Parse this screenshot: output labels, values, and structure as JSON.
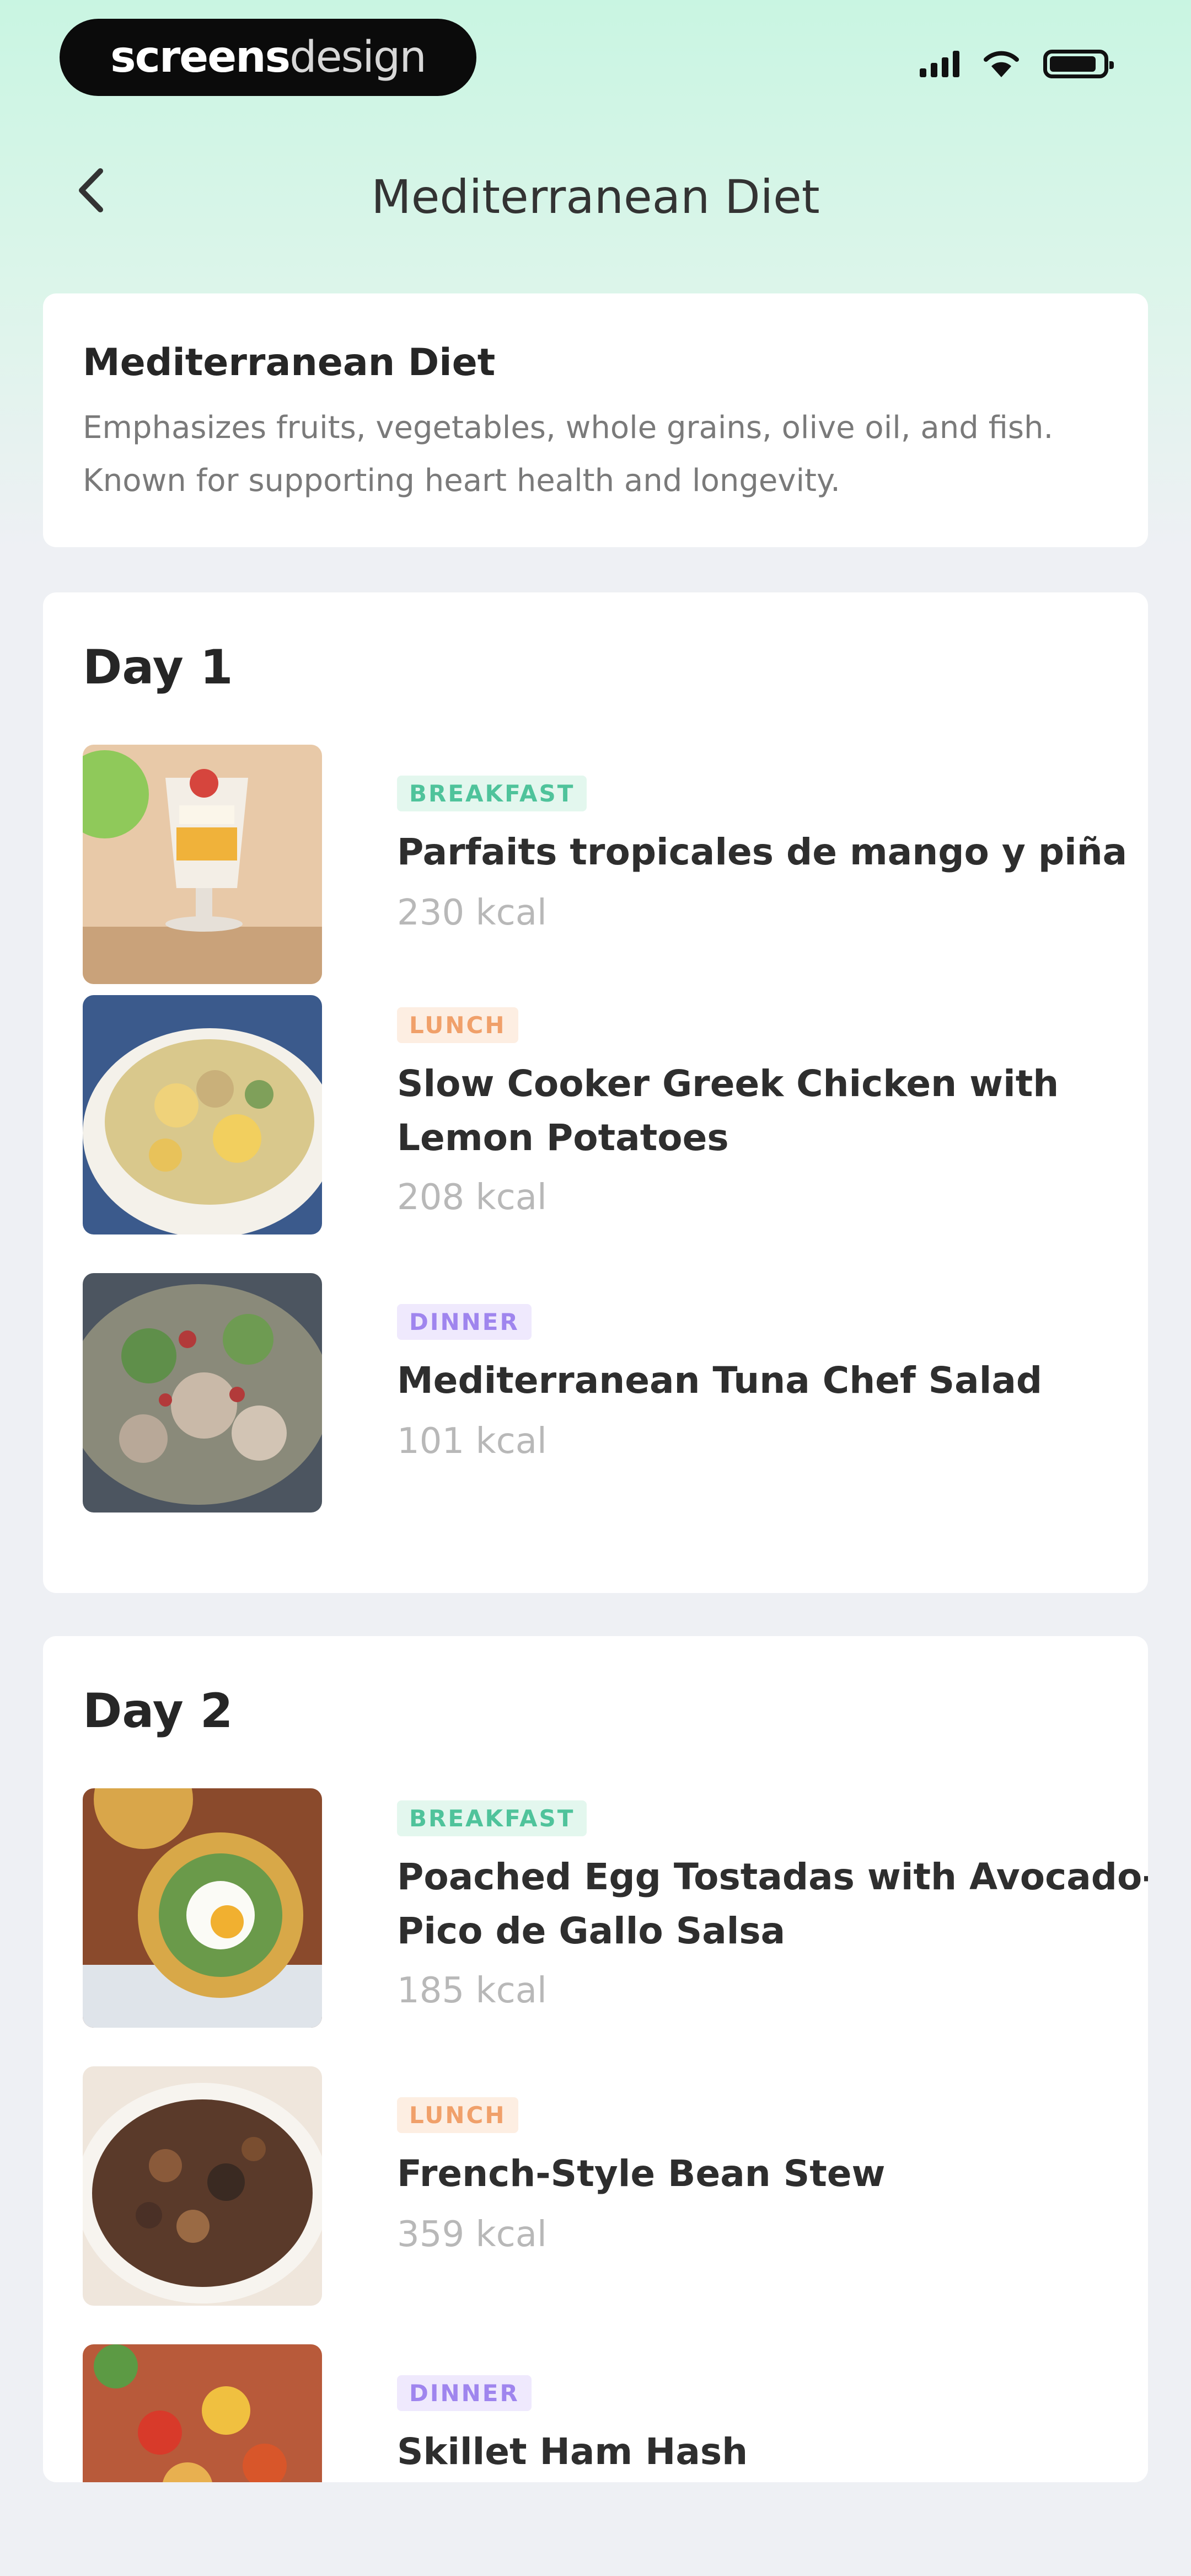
{
  "status": {
    "brand_bold": "screens",
    "brand_light": "design"
  },
  "nav": {
    "title": "Mediterranean Diet",
    "back_icon": "chevron-left-icon"
  },
  "intro": {
    "title": "Mediterranean Diet",
    "description": "Emphasizes fruits, vegetables, whole grains, olive oil, and fish. Known for supporting heart health and longevity."
  },
  "days": [
    {
      "title": "Day 1",
      "meals": [
        {
          "tag": "BREAKFAST",
          "name": "Parfaits tropicales de mango y piña",
          "kcal": "230 kcal"
        },
        {
          "tag": "LUNCH",
          "name": "Slow Cooker Greek Chicken with Lemon Potatoes",
          "kcal": "208 kcal"
        },
        {
          "tag": "DINNER",
          "name": "Mediterranean Tuna Chef Salad",
          "kcal": "101 kcal"
        }
      ]
    },
    {
      "title": "Day 2",
      "meals": [
        {
          "tag": "BREAKFAST",
          "name": "Poached Egg Tostadas with Avocado-Pico de Gallo Salsa",
          "kcal": "185 kcal"
        },
        {
          "tag": "LUNCH",
          "name": "French-Style Bean Stew",
          "kcal": "359 kcal"
        },
        {
          "tag": "DINNER",
          "name": "Skillet Ham Hash",
          "kcal": ""
        }
      ]
    }
  ],
  "colors": {
    "accent_mint": "#c9f5e2",
    "breakfast": "#4fc39b",
    "lunch": "#f0a06a",
    "dinner": "#9f85ee"
  }
}
